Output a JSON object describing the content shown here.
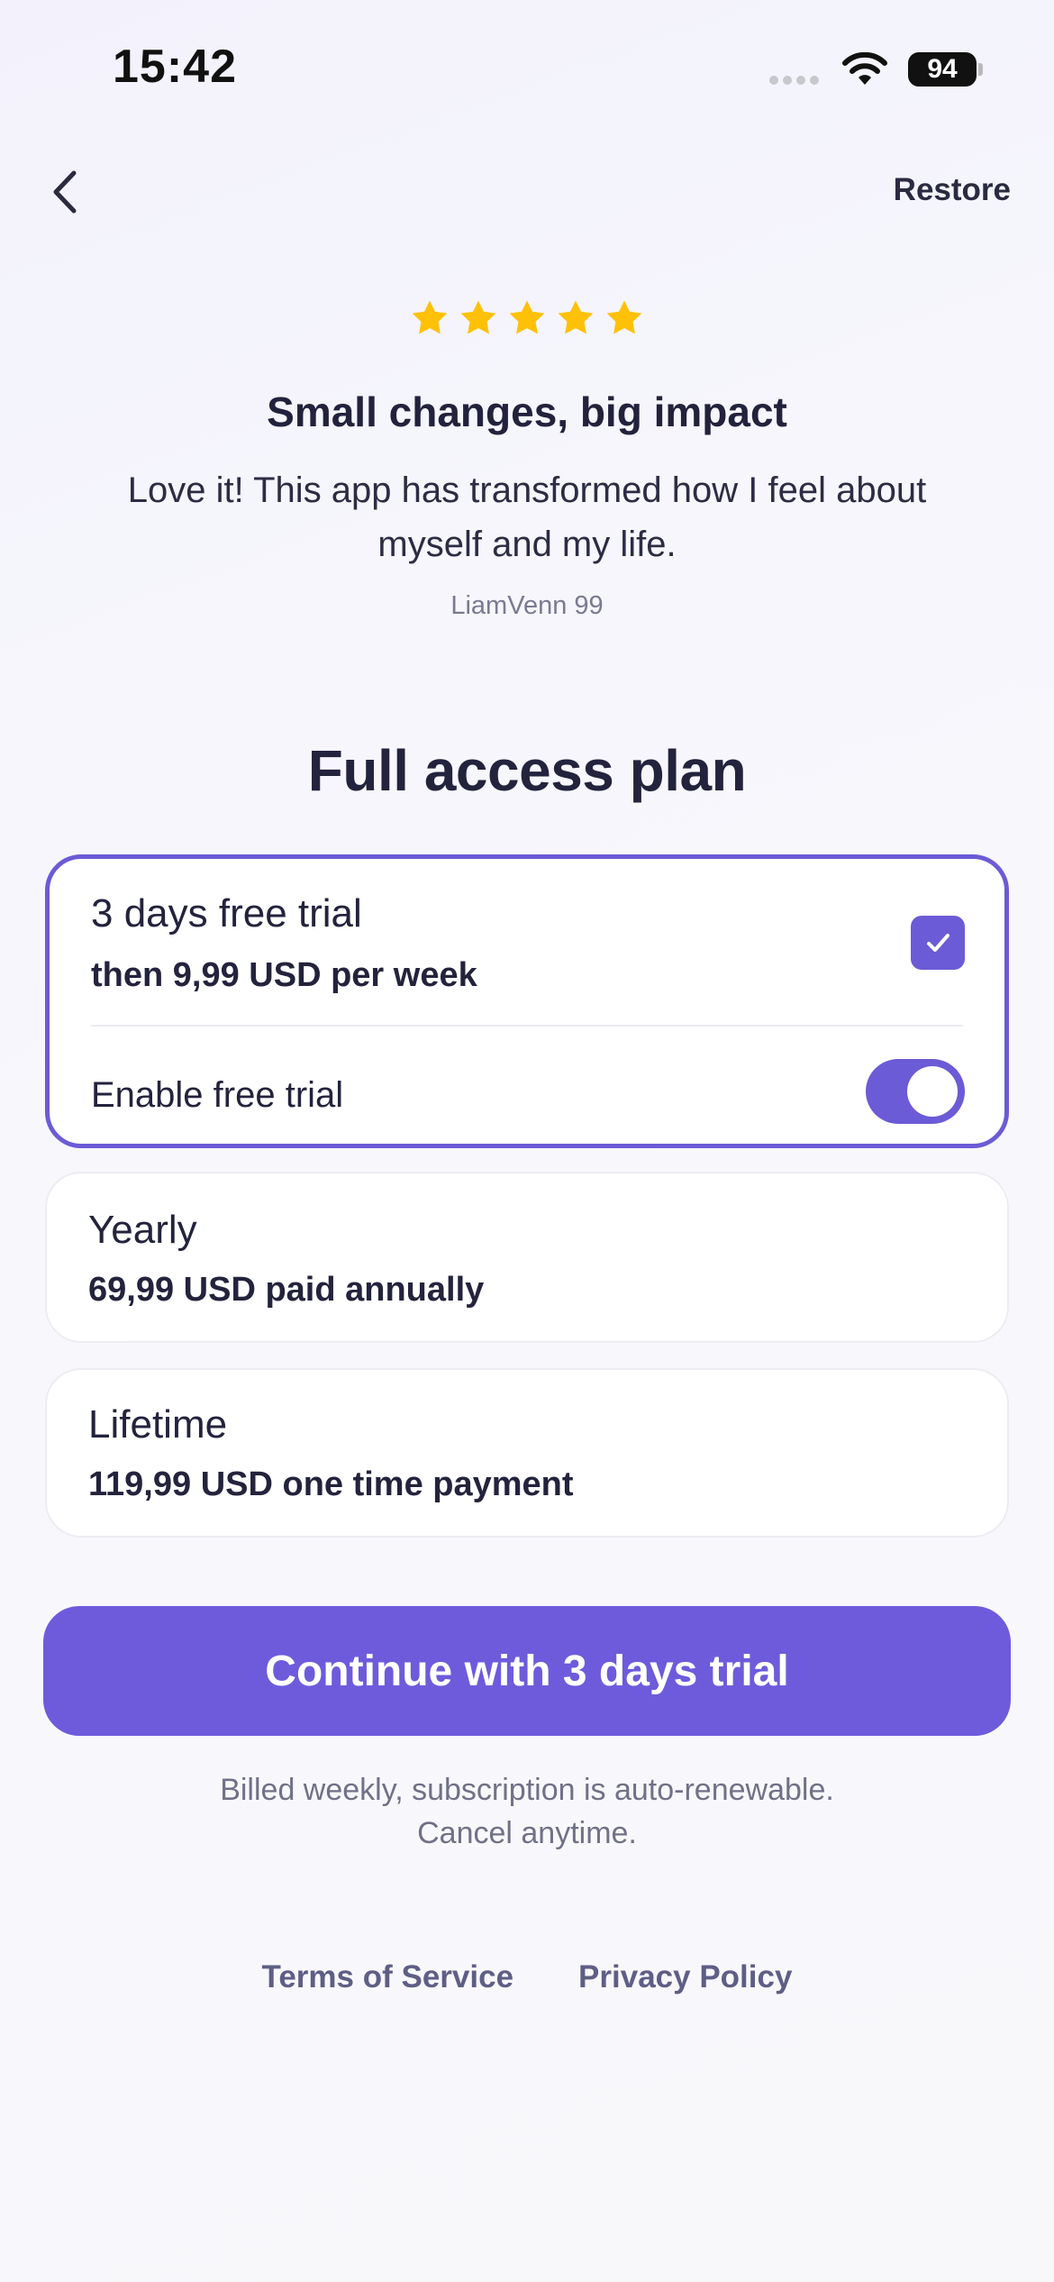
{
  "status_bar": {
    "time": "15:42",
    "battery": "94"
  },
  "nav": {
    "back_icon": "chevron-left-icon",
    "restore_label": "Restore"
  },
  "review": {
    "rating": 5,
    "rating_max": 5,
    "star_color": "#FFC107",
    "title": "Small changes, big impact",
    "body": "Love it! This app has transformed how I feel about myself and my life.",
    "author": "LiamVenn 99"
  },
  "plan_section": {
    "title": "Full access plan"
  },
  "plans": {
    "trial": {
      "label": "3 days free trial",
      "price": "then 9,99 USD per week",
      "selected": true,
      "toggle_label": "Enable free trial",
      "toggle_on": true
    },
    "yearly": {
      "label": "Yearly",
      "price": "69,99 USD paid annually",
      "selected": false
    },
    "lifetime": {
      "label": "Lifetime",
      "price": "119,99 USD one time payment",
      "selected": false
    }
  },
  "cta": {
    "label": "Continue with 3 days trial"
  },
  "billing_note": {
    "line1": "Billed weekly, subscription is auto-renewable.",
    "line2": "Cancel anytime."
  },
  "footer_links": {
    "terms": "Terms of Service",
    "privacy": "Privacy Policy"
  },
  "colors": {
    "accent": "#6B5BD6",
    "text": "#23233D",
    "muted": "#707088"
  }
}
